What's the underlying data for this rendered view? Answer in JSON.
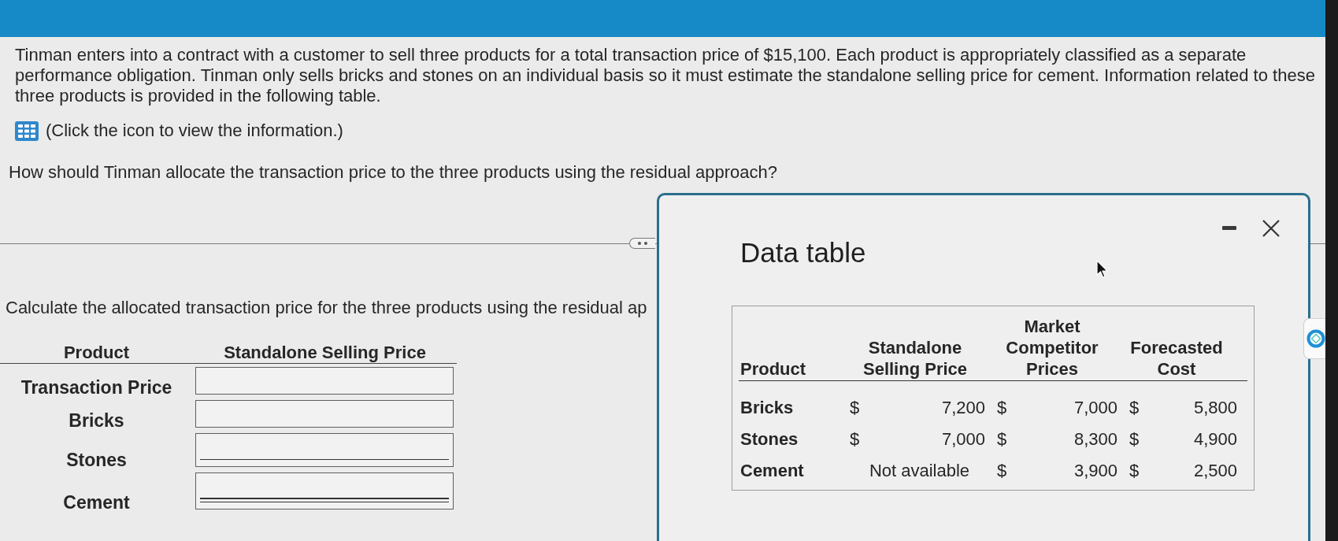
{
  "question": {
    "intro": "Tinman enters into a contract with a customer to sell three products for a total transaction price of $15,100. Each product is appropriately classified as a separate performance obligation. Tinman only sells bricks and stones on an individual basis so it must estimate the standalone selling price for cement. Information related to these three products is provided in the following table.",
    "info_hint": "(Click the icon to view the information.)",
    "prompt": "How should Tinman allocate the transaction price to the three products using the residual approach?"
  },
  "answer": {
    "instruction": "Calculate the allocated transaction price for the three products using the residual ap",
    "columns": [
      "Product",
      "Standalone Selling Price"
    ],
    "rows": [
      {
        "label": "Transaction Price",
        "kind": "plain"
      },
      {
        "label": "Bricks",
        "kind": "plain"
      },
      {
        "label": "Stones",
        "kind": "subtotal"
      },
      {
        "label": "Cement",
        "kind": "total"
      }
    ]
  },
  "dialog": {
    "title": "Data table",
    "table": {
      "columns": [
        "Product",
        "",
        "Standalone Selling Price",
        "",
        "Market Competitor Prices",
        "",
        "Forecasted Cost"
      ],
      "rows": [
        [
          "Bricks",
          "$",
          "7,200",
          "$",
          "7,000",
          "$",
          "5,800"
        ],
        [
          "Stones",
          "$",
          "7,000",
          "$",
          "8,300",
          "$",
          "4,900"
        ],
        [
          "Cement",
          "",
          "Not available",
          "$",
          "3,900",
          "$",
          "2,500"
        ]
      ]
    }
  }
}
